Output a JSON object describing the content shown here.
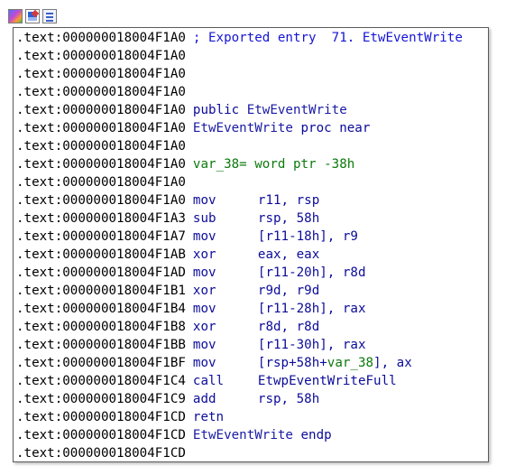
{
  "toolbar": {
    "icons": [
      "graph-overview-icon",
      "edit-pen-icon",
      "list-view-icon"
    ]
  },
  "disassembly": {
    "lines": [
      {
        "addr": ".text:000000018004F1A0",
        "kind": "comment",
        "text": "; Exported entry  71. EtwEventWrite"
      },
      {
        "addr": ".text:000000018004F1A0",
        "kind": "blank"
      },
      {
        "addr": ".text:000000018004F1A0",
        "kind": "blank"
      },
      {
        "addr": ".text:000000018004F1A0",
        "kind": "blank"
      },
      {
        "addr": ".text:000000018004F1A0",
        "kind": "decl",
        "keyword": "public",
        "name": "EtwEventWrite"
      },
      {
        "addr": ".text:000000018004F1A0",
        "kind": "proc",
        "name": "EtwEventWrite",
        "keyword": "proc near"
      },
      {
        "addr": ".text:000000018004F1A0",
        "kind": "blank"
      },
      {
        "addr": ".text:000000018004F1A0",
        "kind": "var",
        "var": "var_38",
        "def": "= word ptr -38h"
      },
      {
        "addr": ".text:000000018004F1A0",
        "kind": "blank"
      },
      {
        "addr": ".text:000000018004F1A0",
        "kind": "insn",
        "mnem": "mov",
        "ops": "r11, rsp"
      },
      {
        "addr": ".text:000000018004F1A3",
        "kind": "insn",
        "mnem": "sub",
        "ops": "rsp, 58h"
      },
      {
        "addr": ".text:000000018004F1A7",
        "kind": "insn",
        "mnem": "mov",
        "ops": "[r11-18h], r9"
      },
      {
        "addr": ".text:000000018004F1AB",
        "kind": "insn",
        "mnem": "xor",
        "ops": "eax, eax"
      },
      {
        "addr": ".text:000000018004F1AD",
        "kind": "insn",
        "mnem": "mov",
        "ops": "[r11-20h], r8d"
      },
      {
        "addr": ".text:000000018004F1B1",
        "kind": "insn",
        "mnem": "xor",
        "ops": "r9d, r9d"
      },
      {
        "addr": ".text:000000018004F1B4",
        "kind": "insn",
        "mnem": "mov",
        "ops": "[r11-28h], rax"
      },
      {
        "addr": ".text:000000018004F1B8",
        "kind": "insn",
        "mnem": "xor",
        "ops": "r8d, r8d"
      },
      {
        "addr": ".text:000000018004F1BB",
        "kind": "insn",
        "mnem": "mov",
        "ops": "[r11-30h], rax"
      },
      {
        "addr": ".text:000000018004F1BF",
        "kind": "insn_var",
        "mnem": "mov",
        "ops_pre": "[rsp+58h+",
        "ops_var": "var_38",
        "ops_post": "], ax"
      },
      {
        "addr": ".text:000000018004F1C4",
        "kind": "insn",
        "mnem": "call",
        "ops": "EtwpEventWriteFull"
      },
      {
        "addr": ".text:000000018004F1C9",
        "kind": "insn",
        "mnem": "add",
        "ops": "rsp, 58h"
      },
      {
        "addr": ".text:000000018004F1CD",
        "kind": "insn",
        "mnem": "retn",
        "ops": ""
      },
      {
        "addr": ".text:000000018004F1CD",
        "kind": "endp",
        "name": "EtwEventWrite",
        "keyword": "endp"
      },
      {
        "addr": ".text:000000018004F1CD",
        "kind": "blank"
      }
    ]
  }
}
